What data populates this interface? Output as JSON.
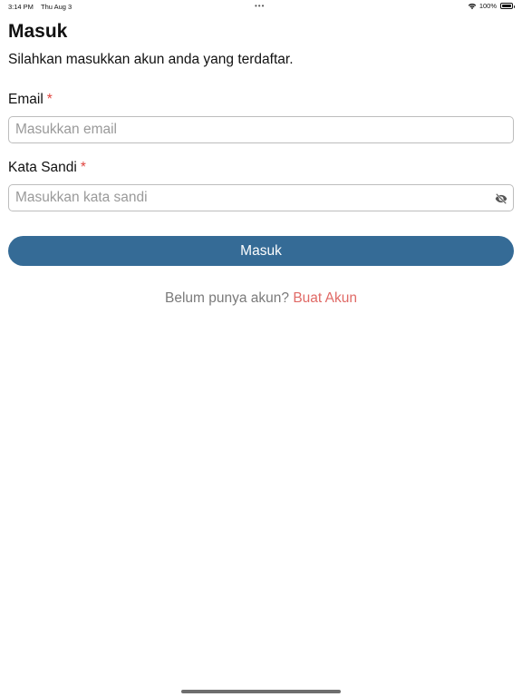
{
  "status_bar": {
    "time": "3:14 PM",
    "date": "Thu Aug 3",
    "dots": "•••",
    "battery_text": "100%",
    "battery_level": 1.0
  },
  "page": {
    "title": "Masuk",
    "subtitle": "Silahkan masukkan akun anda yang terdaftar."
  },
  "form": {
    "email": {
      "label": "Email",
      "required_mark": "*",
      "value": "",
      "placeholder": "Masukkan email"
    },
    "password": {
      "label": "Kata Sandi",
      "required_mark": "*",
      "value": "",
      "placeholder": "Masukkan kata sandi",
      "toggle_icon": "eye-off-icon"
    },
    "submit_label": "Masuk"
  },
  "register": {
    "prompt": "Belum punya akun?",
    "link_label": "Buat Akun"
  },
  "colors": {
    "primary": "#356b96",
    "required": "#e0443e",
    "link": "#e06a66",
    "muted": "#7a7a7a"
  }
}
